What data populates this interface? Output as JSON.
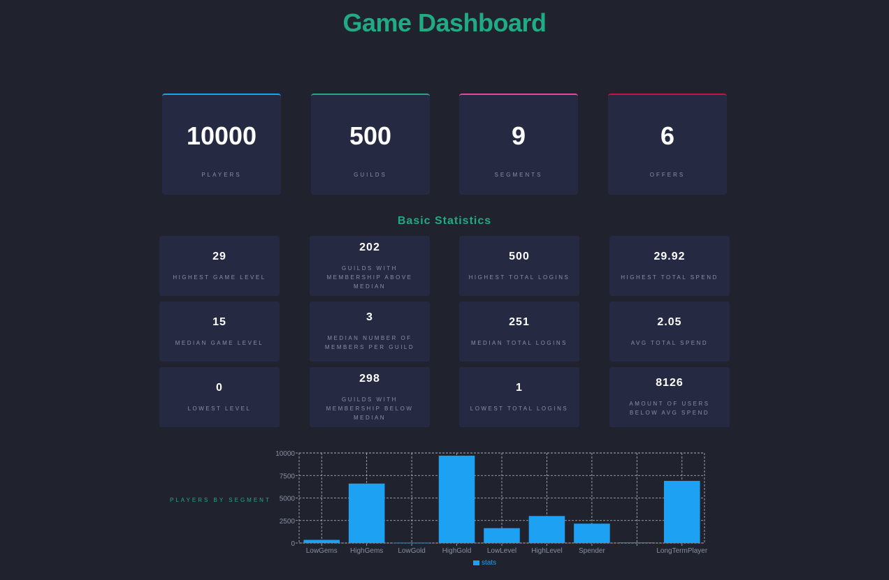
{
  "header": {
    "title": "Game Dashboard"
  },
  "kpis": [
    {
      "value": "10000",
      "label": "PLAYERS",
      "accent": "#1da1f2"
    },
    {
      "value": "500",
      "label": "GUILDS",
      "accent": "#21ab84"
    },
    {
      "value": "9",
      "label": "SEGMENTS",
      "accent": "#e04aa4"
    },
    {
      "value": "6",
      "label": "OFFERS",
      "accent": "#c4153a"
    }
  ],
  "basic_statistics": {
    "title": "Basic Statistics",
    "cards": [
      {
        "value": "29",
        "label": "HIGHEST GAME LEVEL"
      },
      {
        "value": "202",
        "label": "GUILDS WITH MEMBERSHIP ABOVE MEDIAN"
      },
      {
        "value": "500",
        "label": "HIGHEST TOTAL LOGINS"
      },
      {
        "value": "29.92",
        "label": "HIGHEST TOTAL SPEND"
      },
      {
        "value": "15",
        "label": "MEDIAN GAME LEVEL"
      },
      {
        "value": "3",
        "label": "MEDIAN NUMBER OF MEMBERS PER GUILD"
      },
      {
        "value": "251",
        "label": "MEDIAN TOTAL LOGINS"
      },
      {
        "value": "2.05",
        "label": "AVG TOTAL SPEND"
      },
      {
        "value": "0",
        "label": "LOWEST LEVEL"
      },
      {
        "value": "298",
        "label": "GUILDS WITH MEMBERSHIP BELOW MEDIAN"
      },
      {
        "value": "1",
        "label": "LOWEST TOTAL LOGINS"
      },
      {
        "value": "8126",
        "label": "AMOUNT OF USERS BELOW AVG SPEND"
      }
    ]
  },
  "chart_section": {
    "label": "PLAYERS BY SEGMENT"
  },
  "chart_data": {
    "type": "bar",
    "categories": [
      "LowGems",
      "HighGems",
      "LowGold",
      "HighGold",
      "LowLevel",
      "HighLevel",
      "Spender",
      "",
      "LongTermPlayer"
    ],
    "series": [
      {
        "name": "stats",
        "values": [
          350,
          6600,
          40,
          9700,
          1650,
          3000,
          2150,
          60,
          6900
        ]
      }
    ],
    "ylim": [
      0,
      10000
    ],
    "yticks": [
      0,
      2500,
      5000,
      7500,
      10000
    ],
    "grid": true,
    "legend": "bottom",
    "color": "#1da1f2"
  }
}
